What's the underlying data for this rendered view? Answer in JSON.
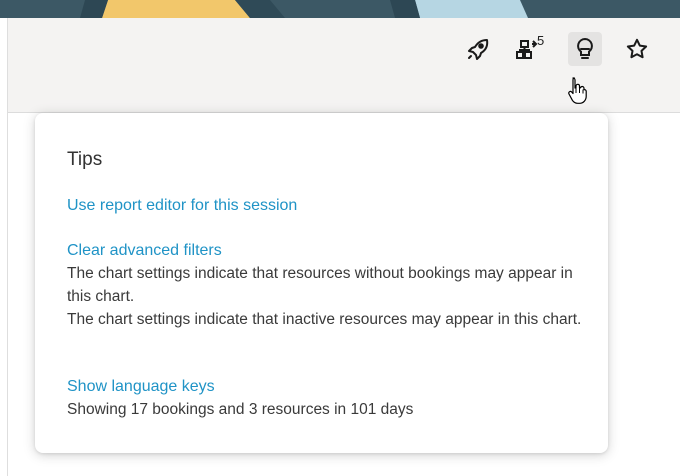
{
  "header": {
    "buttons": [
      {
        "icon": "rocket-icon"
      },
      {
        "icon": "hierarchy-icon",
        "badge": "5"
      },
      {
        "icon": "lightbulb-icon",
        "active": true
      },
      {
        "icon": "star-icon"
      }
    ]
  },
  "tips": {
    "title": "Tips",
    "items": [
      {
        "link": "Use report editor for this session"
      },
      {
        "link": "Clear advanced filters",
        "descriptions": [
          "The chart settings indicate that resources without bookings may appear in this chart.",
          "The chart settings indicate that inactive resources may appear in this chart."
        ]
      },
      {
        "link": "Show language keys",
        "descriptions": [
          "Showing 17 bookings and 3 resources in 101 days"
        ]
      }
    ]
  },
  "colors": {
    "link": "#1f93c6",
    "banner_dark": "#3c5865",
    "banner_yellow": "#f2c76b",
    "banner_light_blue": "#b6d6e3",
    "header_bg": "#f4f3f2"
  }
}
